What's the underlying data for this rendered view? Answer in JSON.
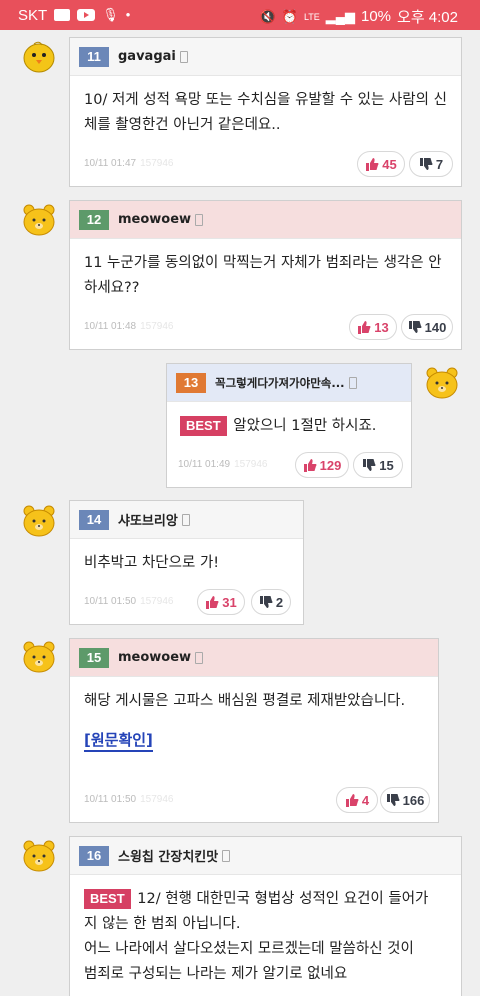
{
  "statusbar": {
    "carrier": "SKT",
    "network": "LTE",
    "battery": "10%",
    "time": "오후 4:02"
  },
  "colors": {
    "statusbar": "#e8505b",
    "up_vote": "#d9436a",
    "best_badge": "#d64063",
    "link": "#2544b8"
  },
  "comments": [
    {
      "number": "11",
      "user": "gavagai",
      "avatar": "chick-icon",
      "header_style": "plain",
      "text": "10/ 저게 성적 욕망 또는 수치심을 유발할 수 있는 사람의 신체를 촬영한건 아닌거 같은데요..",
      "time": "10/11 01:47",
      "id": "157946",
      "up": "45",
      "down": "7"
    },
    {
      "number": "12",
      "user": "meowoew",
      "avatar": "bear-icon",
      "header_style": "pink",
      "text": "11 누군가를 동의없이 막찍는거 자체가 범죄라는 생각은 안하세요??",
      "time": "10/11 01:48",
      "id": "157946",
      "up": "13",
      "down": "140"
    },
    {
      "number": "13",
      "user": "꼭그렇게다가져가야만속...",
      "avatar": "bear-icon",
      "header_style": "blue",
      "best": "BEST",
      "text": "알았으니 1절만 하시죠.",
      "time": "10/11 01:49",
      "id": "157946",
      "up": "129",
      "down": "15"
    },
    {
      "number": "14",
      "user": "샤또브리앙",
      "avatar": "bear-icon",
      "header_style": "plain",
      "text": "비추박고 차단으로 가!",
      "time": "10/11 01:50",
      "id": "157946",
      "up": "31",
      "down": "2"
    },
    {
      "number": "15",
      "user": "meowoew",
      "avatar": "bear-icon",
      "header_style": "pink",
      "text": "해당 게시물은 고파스 배심원 평결로 제재받았습니다.",
      "link": "[원문확인]",
      "time": "10/11 01:50",
      "id": "157946",
      "up": "4",
      "down": "166"
    },
    {
      "number": "16",
      "user": "스윙칩 간장치킨맛",
      "avatar": "bear-icon",
      "header_style": "plain",
      "best": "BEST",
      "text_line1": "12/ 현행 대한민국 형법상 성적인 요건이 들어가",
      "text_line2": "지 않는 한 범죄 아닙니다.",
      "text_line3": "어느 나라에서 살다오셨는지 모르겠는데 말씀하신 것이",
      "text_line4": "범죄로 구성되는 나라는 제가 알기로 없네요"
    }
  ]
}
